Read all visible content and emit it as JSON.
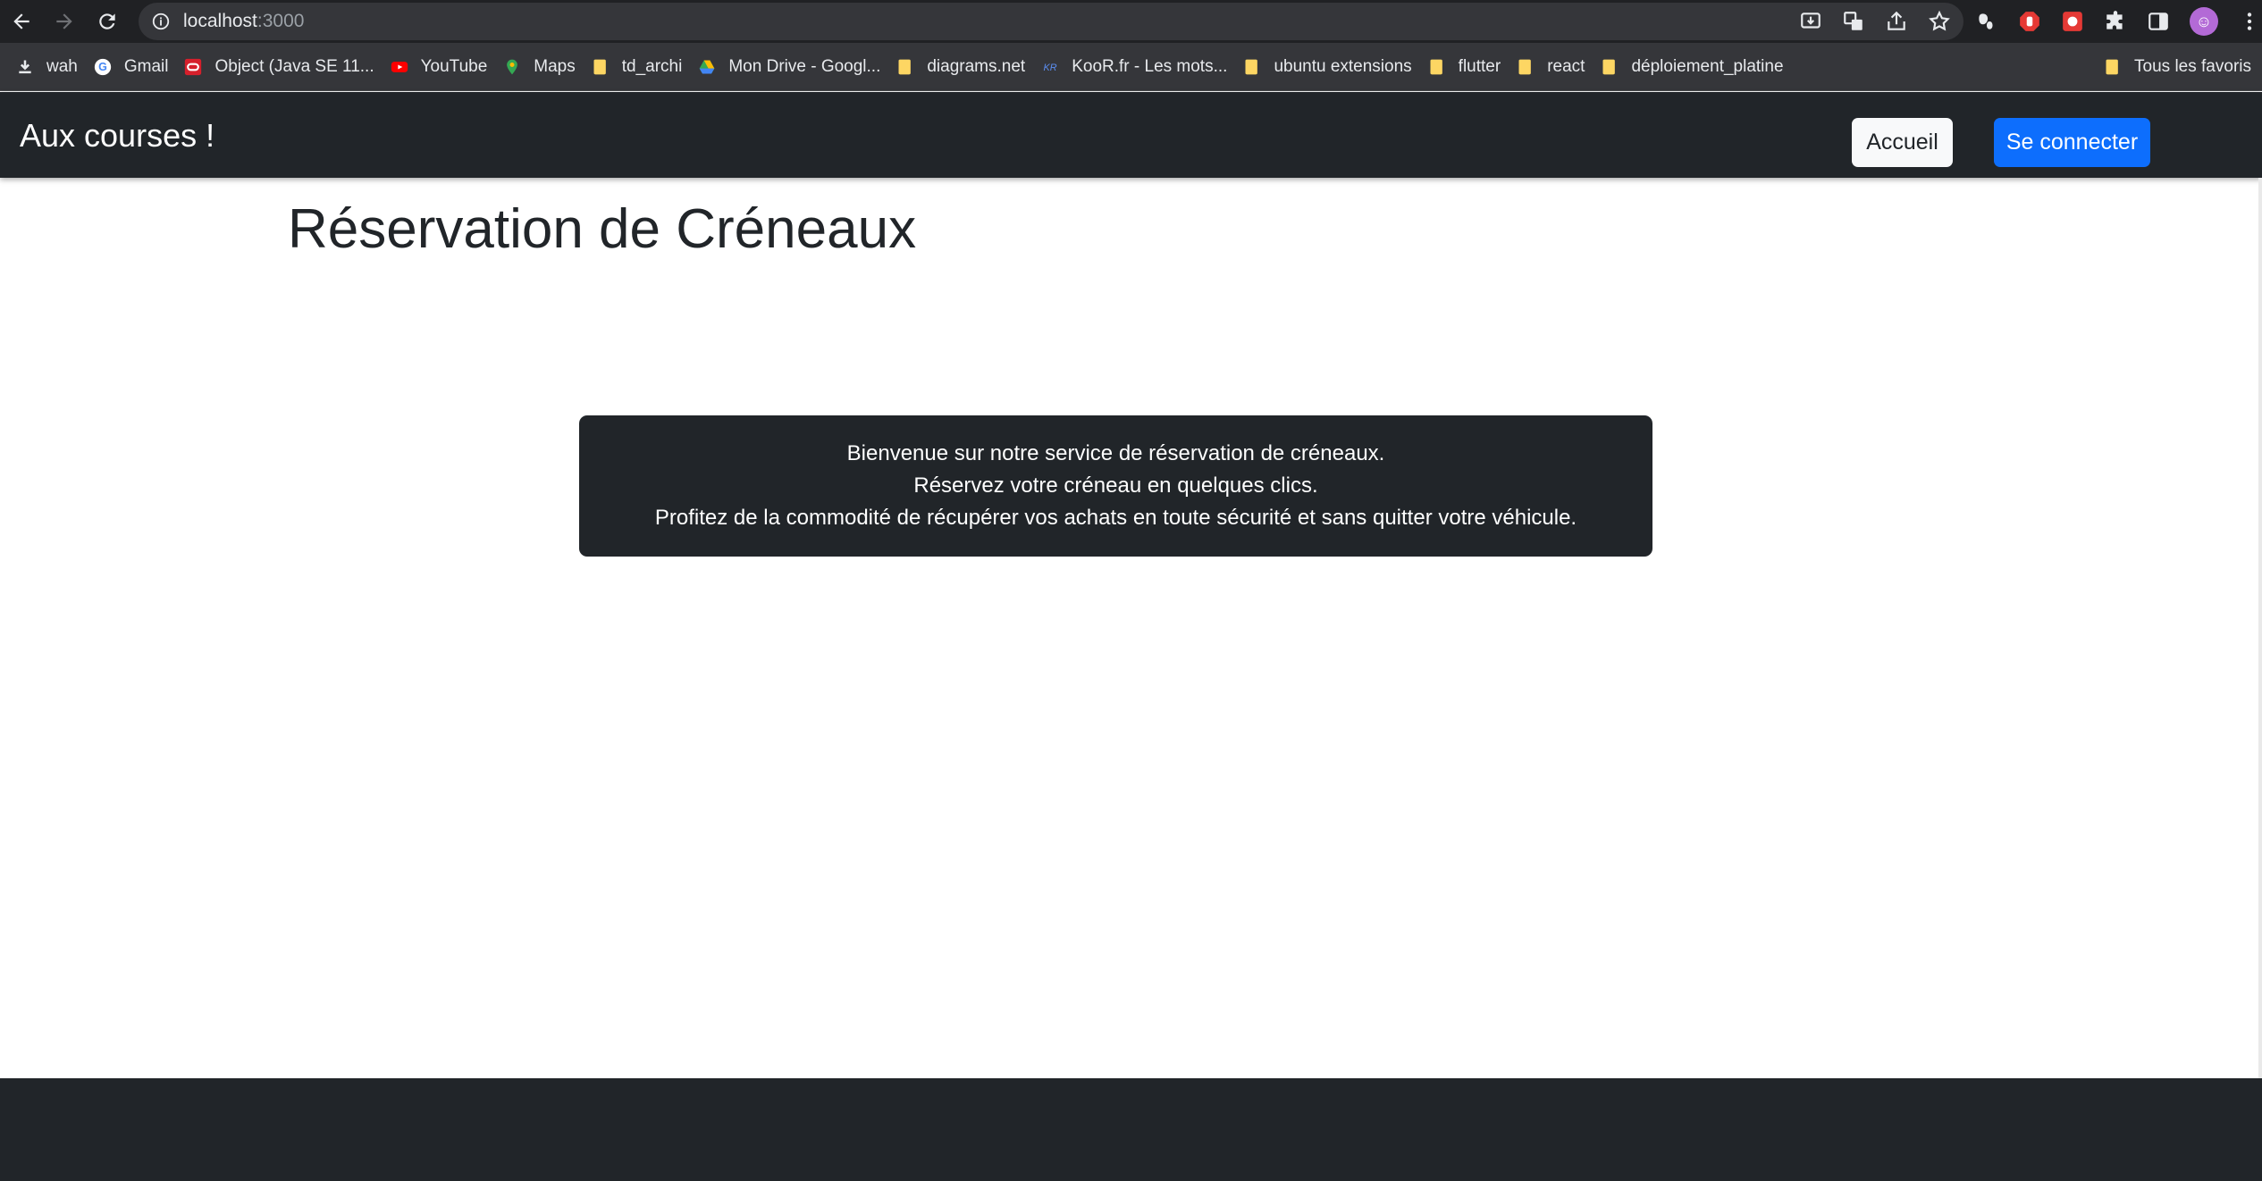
{
  "browser": {
    "url_host": "localhost",
    "url_port": ":3000",
    "bookmarks": [
      {
        "label": "wah",
        "icon": "download-icon"
      },
      {
        "label": "Gmail",
        "icon": "google-icon"
      },
      {
        "label": "Object (Java SE 11...",
        "icon": "oracle-icon"
      },
      {
        "label": "YouTube",
        "icon": "youtube-icon"
      },
      {
        "label": "Maps",
        "icon": "maps-pin-icon"
      },
      {
        "label": "td_archi",
        "icon": "folder-icon"
      },
      {
        "label": "Mon Drive - Googl...",
        "icon": "drive-icon"
      },
      {
        "label": "diagrams.net",
        "icon": "folder-icon"
      },
      {
        "label": "KooR.fr - Les mots...",
        "icon": "koor-icon"
      },
      {
        "label": "ubuntu extensions",
        "icon": "folder-icon"
      },
      {
        "label": "flutter",
        "icon": "folder-icon"
      },
      {
        "label": "react",
        "icon": "folder-icon"
      },
      {
        "label": "déploiement_platine",
        "icon": "folder-icon"
      }
    ],
    "all_bookmarks_label": "Tous les favoris"
  },
  "navbar": {
    "brand": "Aux courses !",
    "home_button": "Accueil",
    "login_button": "Se connecter"
  },
  "main": {
    "title": "Réservation de Créneaux",
    "welcome_lines": [
      "Bienvenue sur notre service de réservation de créneaux.",
      "Réservez votre créneau en quelques clics.",
      "Profitez de la commodité de récupérer vos achats en toute sécurité et sans quitter votre véhicule."
    ]
  },
  "colors": {
    "navbar_bg": "#212529",
    "primary": "#0d6efd",
    "light": "#f8f9fa"
  }
}
